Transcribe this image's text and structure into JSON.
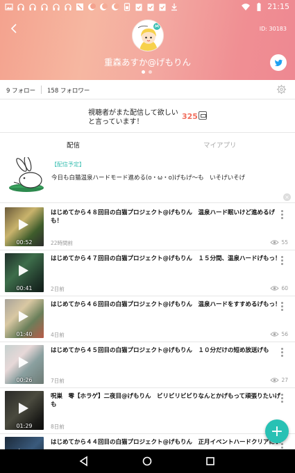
{
  "status_bar": {
    "time": "21:15",
    "icons": [
      "gallery-icon",
      "headphones-icon",
      "headphones-icon",
      "headphones-icon",
      "headphones-icon",
      "headphones-icon",
      "mute-icon",
      "moon-icon",
      "moon-icon",
      "moon-icon",
      "sim-icon",
      "check-clipboard-icon",
      "check-clipboard-icon",
      "check-clipboard-icon",
      "download-icon",
      "wifi-icon",
      "battery-icon"
    ]
  },
  "profile": {
    "user_id": "ID: 30183",
    "username": "重森あすか@げもりん",
    "follow_label": "9 フォロー",
    "follower_label": "158 フォロワー"
  },
  "request": {
    "line1": "視聴者がまた配信して欲しい",
    "line2": "と言っています！",
    "count": "325"
  },
  "tabs": {
    "broadcast": "配信",
    "my_app": "マイアプリ"
  },
  "scheduled": {
    "tag": "【配信予定】",
    "text": "今日も白猫温泉ハードモード進める(o・ω・o)げもげ～も　いそげいそげ"
  },
  "videos": [
    {
      "title": "はじめてから４８回目の白猫プロジェクト@げもりん　温泉ハード眠いけど進めるげも！",
      "duration": "00:52",
      "time": "22時間前",
      "views": "55"
    },
    {
      "title": "はじめてから４７回目の白猫プロジェクト@げもりん　１５分間、温泉ハードげもっ！",
      "duration": "00:41",
      "time": "2日前",
      "views": "60"
    },
    {
      "title": "はじめてから４６回目の白猫プロジェクト@げもりん　温泉ハードをすすめるげもっ！",
      "duration": "01:40",
      "time": "4日前",
      "views": "56"
    },
    {
      "title": "はじめてから４５回目の白猫プロジェクト@げもりん　１０分だけの短め放送げも",
      "duration": "00:26",
      "time": "7日前",
      "views": "27"
    },
    {
      "title": "呪巣　零【ホラゲ】二夜目@げもりん　ビリビリビビりなんとかげもって頑張りたいげも",
      "duration": "01:29",
      "time": "8日前",
      "views": ""
    },
    {
      "title": "はじめてから４４回目の白猫プロジェクト@げもりん　正月イベントハードクリアにい",
      "duration": "",
      "time": "",
      "views": ""
    }
  ],
  "colors": {
    "accent": "#28c1b4",
    "request_count": "#f26f5e",
    "header_from": "#f4a28e",
    "header_to": "#ee8892"
  }
}
